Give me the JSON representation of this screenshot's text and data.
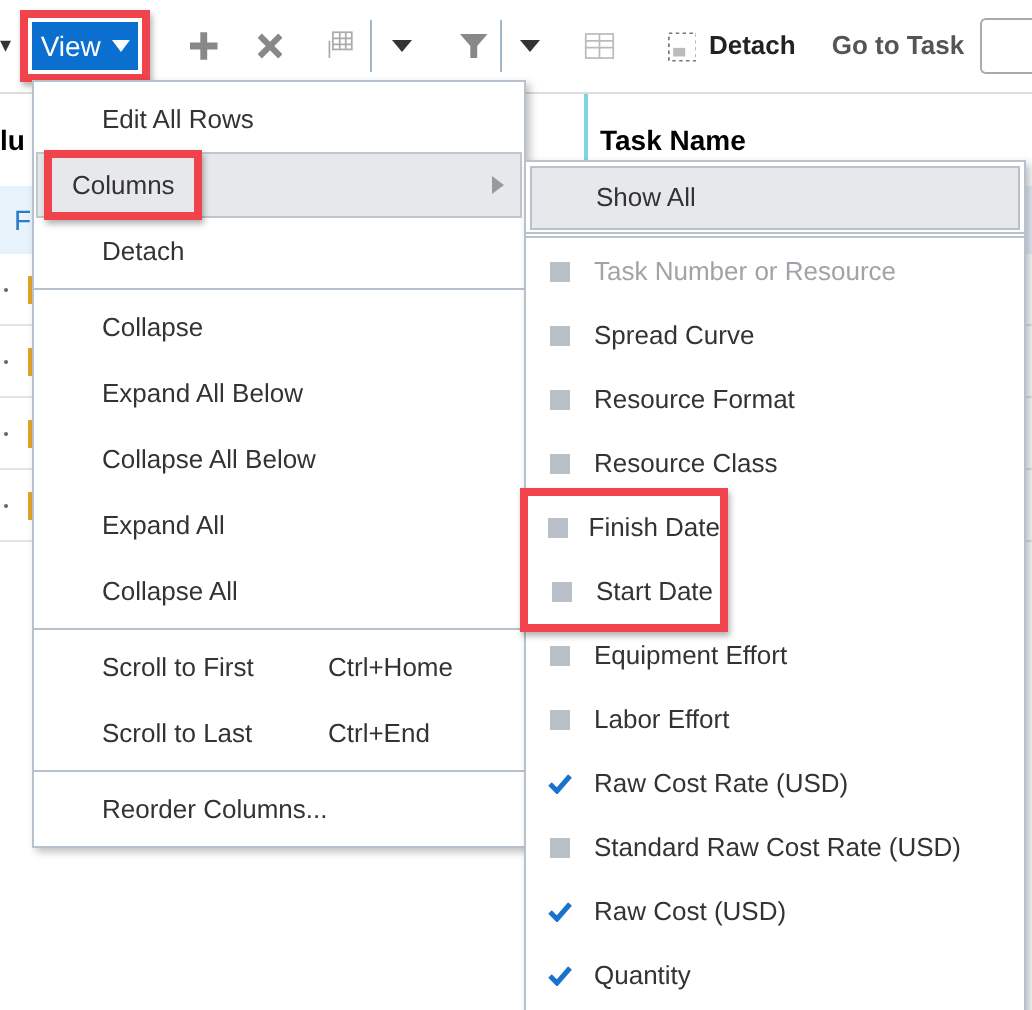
{
  "toolbar": {
    "overflow_caret": "▾",
    "view_button": {
      "label": "View",
      "highlighted": true
    },
    "detach_label": "Detach",
    "go_to_task_label": "Go to Task"
  },
  "table": {
    "columns": [
      "lu",
      "Task Name"
    ],
    "rows": [
      {
        "text": "F",
        "selected": true
      }
    ]
  },
  "menu": {
    "items": [
      {
        "kind": "item",
        "label": "Edit All Rows",
        "selected": false,
        "highlighted": false
      },
      {
        "kind": "submenu",
        "label": "Columns",
        "selected": true,
        "highlighted": true
      },
      {
        "kind": "item",
        "label": "Detach",
        "selected": false,
        "highlighted": false
      },
      {
        "kind": "divider"
      },
      {
        "kind": "item",
        "label": "Collapse",
        "selected": false,
        "highlighted": false
      },
      {
        "kind": "item",
        "label": "Expand All Below",
        "selected": false,
        "highlighted": false
      },
      {
        "kind": "item",
        "label": "Collapse All Below",
        "selected": false,
        "highlighted": false
      },
      {
        "kind": "item",
        "label": "Expand All",
        "selected": false,
        "highlighted": false
      },
      {
        "kind": "item",
        "label": "Collapse All",
        "selected": false,
        "highlighted": false
      },
      {
        "kind": "divider"
      },
      {
        "kind": "item",
        "label": "Scroll to First",
        "shortcut": "Ctrl+Home",
        "selected": false,
        "highlighted": false
      },
      {
        "kind": "item",
        "label": "Scroll to Last",
        "shortcut": "Ctrl+End",
        "selected": false,
        "highlighted": false
      },
      {
        "kind": "divider"
      },
      {
        "kind": "item",
        "label": "Reorder Columns...",
        "selected": false,
        "highlighted": false
      }
    ]
  },
  "submenu": {
    "items": [
      {
        "kind": "action",
        "label": "Show All",
        "selected": true
      },
      {
        "kind": "divider"
      },
      {
        "kind": "check",
        "label": "Task Number or Resource",
        "checked": false,
        "disabled": true,
        "highlighted": false
      },
      {
        "kind": "check",
        "label": "Spread Curve",
        "checked": false,
        "disabled": false,
        "highlighted": false
      },
      {
        "kind": "check",
        "label": "Resource Format",
        "checked": false,
        "disabled": false,
        "highlighted": false
      },
      {
        "kind": "check",
        "label": "Resource Class",
        "checked": false,
        "disabled": false,
        "highlighted": false
      },
      {
        "kind": "check",
        "label": "Finish Date",
        "checked": false,
        "disabled": false,
        "highlighted": true
      },
      {
        "kind": "check",
        "label": "Start Date",
        "checked": false,
        "disabled": false,
        "highlighted": true
      },
      {
        "kind": "check",
        "label": "Equipment Effort",
        "checked": false,
        "disabled": false,
        "highlighted": false
      },
      {
        "kind": "check",
        "label": "Labor Effort",
        "checked": false,
        "disabled": false,
        "highlighted": false
      },
      {
        "kind": "check",
        "label": "Raw Cost Rate (USD)",
        "checked": true,
        "disabled": false,
        "highlighted": false
      },
      {
        "kind": "check",
        "label": "Standard Raw Cost Rate (USD)",
        "checked": false,
        "disabled": false,
        "highlighted": false
      },
      {
        "kind": "check",
        "label": "Raw Cost (USD)",
        "checked": true,
        "disabled": false,
        "highlighted": false
      },
      {
        "kind": "check",
        "label": "Quantity",
        "checked": true,
        "disabled": false,
        "highlighted": false
      }
    ]
  }
}
